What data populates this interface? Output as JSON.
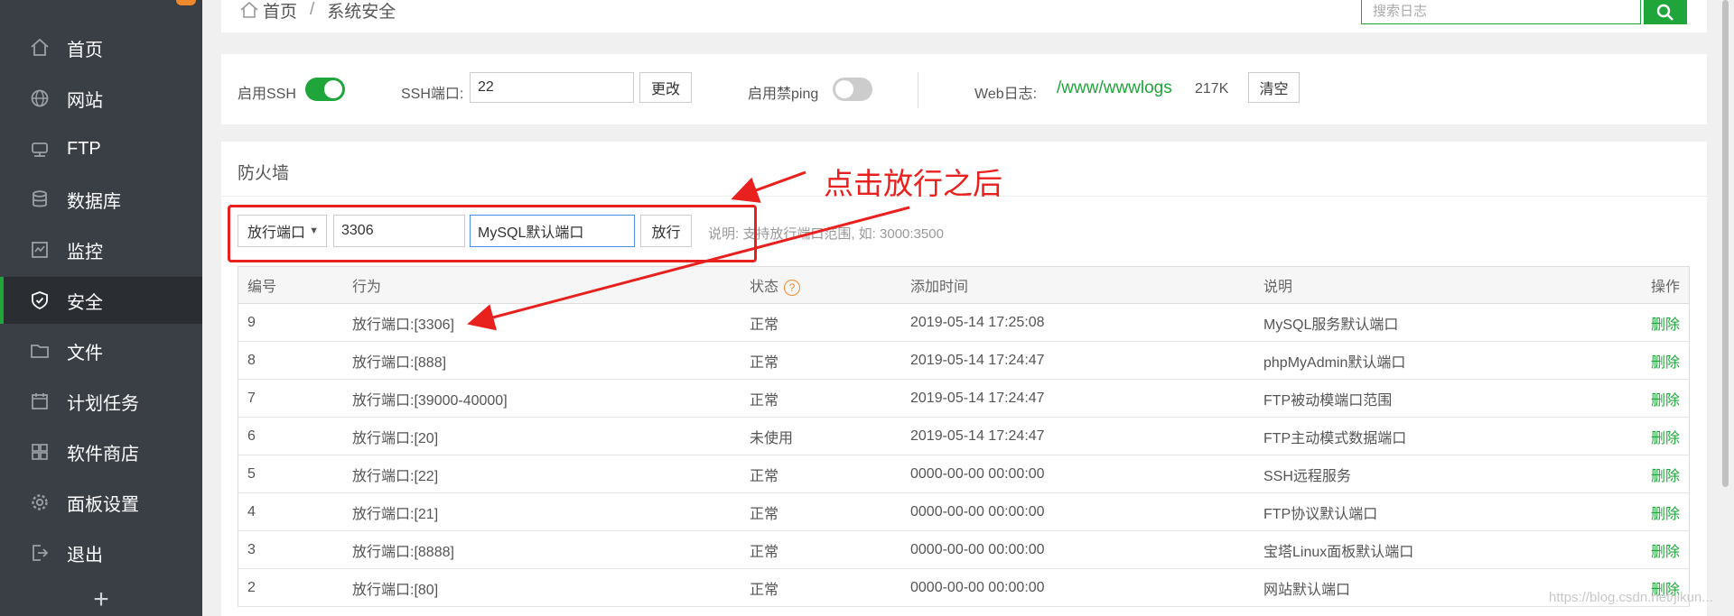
{
  "sidebar": {
    "items": [
      {
        "label": "首页",
        "icon": "home-icon"
      },
      {
        "label": "网站",
        "icon": "globe-icon"
      },
      {
        "label": "FTP",
        "icon": "ftp-icon"
      },
      {
        "label": "数据库",
        "icon": "database-icon"
      },
      {
        "label": "监控",
        "icon": "monitor-icon"
      },
      {
        "label": "安全",
        "icon": "shield-icon",
        "active": true
      },
      {
        "label": "文件",
        "icon": "folder-icon"
      },
      {
        "label": "计划任务",
        "icon": "calendar-icon"
      },
      {
        "label": "软件商店",
        "icon": "grid-icon"
      },
      {
        "label": "面板设置",
        "icon": "gear-icon"
      },
      {
        "label": "退出",
        "icon": "logout-icon"
      }
    ],
    "add_label": "+"
  },
  "breadcrumb": {
    "home": "首页",
    "sep": "/",
    "current": "系统安全"
  },
  "search": {
    "placeholder": "搜索日志"
  },
  "ssh": {
    "enable_label": "启用SSH",
    "enabled": true,
    "port_label": "SSH端口:",
    "port_value": "22",
    "change_button": "更改",
    "ping_label": "启用禁ping",
    "ping_enabled": false,
    "weblog_label": "Web日志:",
    "weblog_path": "/www/wwwlogs",
    "weblog_size": "217K",
    "clear_button": "清空"
  },
  "firewall": {
    "title": "防火墙",
    "select_value": "放行端口",
    "port_value": "3306",
    "note_value": "MySQL默认端口",
    "allow_button": "放行",
    "hint": "说明: 支持放行端口范围, 如: 3000:3500",
    "columns": [
      "编号",
      "行为",
      "状态",
      "添加时间",
      "说明",
      "操作"
    ],
    "rows": [
      {
        "id": "9",
        "action": "放行端口:[3306]",
        "status": "正常",
        "time": "2019-05-14 17:25:08",
        "desc": "MySQL服务默认端口",
        "op": "删除"
      },
      {
        "id": "8",
        "action": "放行端口:[888]",
        "status": "正常",
        "time": "2019-05-14 17:24:47",
        "desc": "phpMyAdmin默认端口",
        "op": "删除"
      },
      {
        "id": "7",
        "action": "放行端口:[39000-40000]",
        "status": "正常",
        "time": "2019-05-14 17:24:47",
        "desc": "FTP被动模端口范围",
        "op": "删除"
      },
      {
        "id": "6",
        "action": "放行端口:[20]",
        "status": "未使用",
        "time": "2019-05-14 17:24:47",
        "desc": "FTP主动模式数据端口",
        "op": "删除"
      },
      {
        "id": "5",
        "action": "放行端口:[22]",
        "status": "正常",
        "time": "0000-00-00 00:00:00",
        "desc": "SSH远程服务",
        "op": "删除"
      },
      {
        "id": "4",
        "action": "放行端口:[21]",
        "status": "正常",
        "time": "0000-00-00 00:00:00",
        "desc": "FTP协议默认端口",
        "op": "删除"
      },
      {
        "id": "3",
        "action": "放行端口:[8888]",
        "status": "正常",
        "time": "0000-00-00 00:00:00",
        "desc": "宝塔Linux面板默认端口",
        "op": "删除"
      },
      {
        "id": "2",
        "action": "放行端口:[80]",
        "status": "正常",
        "time": "0000-00-00 00:00:00",
        "desc": "网站默认端口",
        "op": "删除"
      }
    ]
  },
  "annotation": {
    "text": "点击放行之后"
  },
  "watermark": "https://blog.csdn.net/jikun..."
}
